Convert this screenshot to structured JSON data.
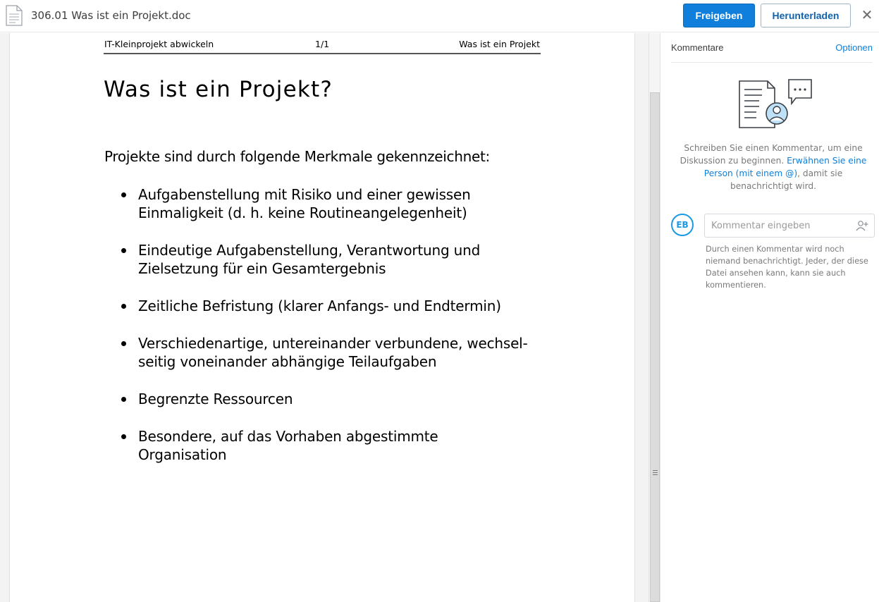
{
  "topbar": {
    "file_icon": "document-icon",
    "file_name": "306.01 Was ist ein Projekt.doc",
    "share_label": "Freigeben",
    "download_label": "Herunterladen",
    "close_symbol": "✕",
    "close_icon": "close-icon",
    "primary_color": "#0f7fdb"
  },
  "document": {
    "header_left": "IT-Kleinprojekt abwickeln",
    "header_center": "1/1",
    "header_right": "Was ist ein Projekt",
    "title": "Was ist ein Projekt?",
    "intro": "Projekte sind durch folgende Merkmale gekennzeichnet:",
    "bullets": [
      {
        "line1": "Aufgabenstellung mit Risiko und einer gewissen",
        "line2": "Einmaligkeit (d. h. keine Routineangelegenheit)"
      },
      {
        "line1": "Eindeutige Aufgabenstellung, Verantwortung und",
        "line2": "Zielsetzung für ein Gesamtergebnis"
      },
      {
        "line1": "Zeitliche Befristung (klarer Anfangs- und Endtermin)",
        "line2": ""
      },
      {
        "line1": "Verschiedenartige, untereinander verbundene, wechsel-",
        "line2": "seitig voneinander abhängige Teilaufgaben"
      },
      {
        "line1": "Begrenzte Ressourcen",
        "line2": ""
      },
      {
        "line1": "Besondere, auf das Vorhaben abgestimmte",
        "line2": "Organisation"
      }
    ]
  },
  "comments": {
    "title": "Kommentare",
    "options_label": "Optionen",
    "illustration_icon": "comment-illustration-icon",
    "empty_text_1": "Schreiben Sie einen Kommentar, um eine Diskussion zu beginnen. ",
    "empty_link": "Erwähnen Sie eine Person (mit einem @)",
    "empty_text_2": ", damit sie benachrichtigt wird.",
    "avatar_initials": "EB",
    "input_placeholder": "Kommentar eingeben",
    "mention_icon": "add-person-icon",
    "hint": "Durch einen Kommentar wird noch niemand benachrichtigt. Jeder, der diese Datei ansehen kann, kann sie auch kommentieren.",
    "accent_color": "#1b9ae4"
  }
}
